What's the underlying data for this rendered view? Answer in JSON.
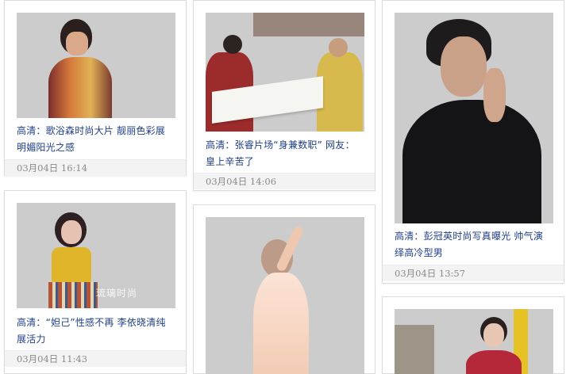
{
  "cards": [
    {
      "title": "高清：歌浴森时尚大片 靓丽色彩展明媚阳光之感",
      "date": "03月04日 16:14"
    },
    {
      "title": "高清：张睿片场“身兼数职” 网友：皇上辛苦了",
      "date": "03月04日 14:06"
    },
    {
      "title": "高清：彭冠英时尚写真曝光 帅气演绎高冷型男",
      "date": "03月04日 13:57"
    },
    {
      "title": "高清：“妲己”性感不再 李依晓清纯展活力",
      "date": "03月04日 11:43"
    },
    {
      "title": "",
      "date": ""
    },
    {
      "title": "",
      "date": ""
    }
  ],
  "photo_overlay_text": "琉璃时尚"
}
